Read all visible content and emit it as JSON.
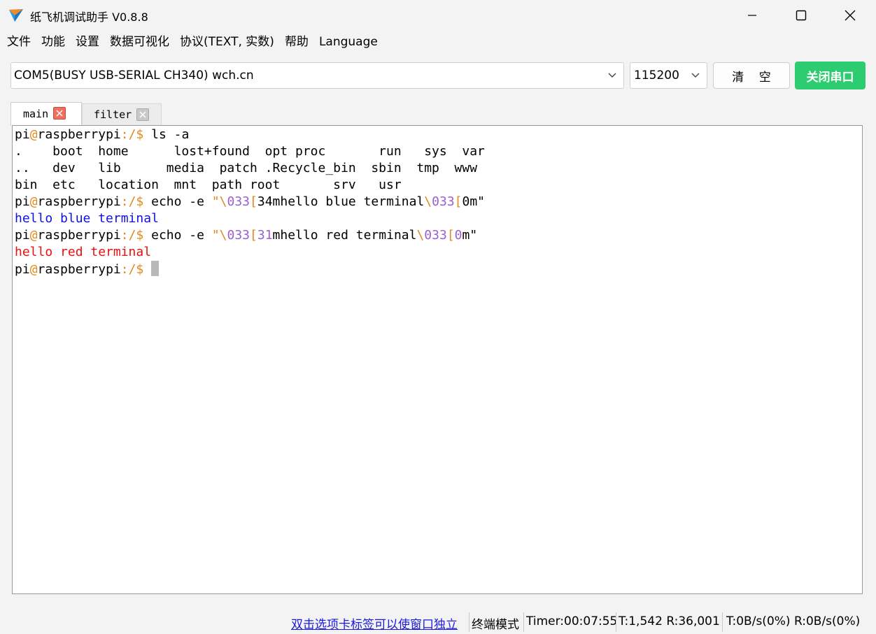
{
  "window": {
    "title": "纸飞机调试助手 V0.8.8",
    "accent": "#2ecc71"
  },
  "menu": [
    "文件",
    "功能",
    "设置",
    "数据可视化",
    "协议(TEXT, 实数)",
    "帮助",
    "Language"
  ],
  "toolbar": {
    "port": "COM5(BUSY  USB-SERIAL CH340) wch.cn",
    "baud": "115200",
    "clear_label": "清 空",
    "close_port_label": "关闭串口"
  },
  "tabs": [
    {
      "label": "main",
      "active": true
    },
    {
      "label": "filter",
      "active": false
    }
  ],
  "terminal": {
    "prompt_user": "pi",
    "prompt_at": "@",
    "prompt_host": "raspberrypi",
    "prompt_path": ":/$",
    "cmd1": " ls -a",
    "ls_rows": [
      ".    boot  home      lost+found  opt proc       run   sys  var",
      "..   dev   lib      media  patch .Recycle_bin  sbin  tmp  www",
      "bin  etc   location  mnt  path root       srv   usr"
    ],
    "echo_prefix": " echo -e ",
    "quote": "\"",
    "backslash": "\\",
    "esc_code": "033",
    "bracket": "[",
    "blue_code": "34",
    "red_code": "31",
    "blue_msg": "mhello blue terminal",
    "red_msg": "mhello red terminal",
    "reset_zero": "0",
    "reset_tail": "m\"",
    "blue_output": "hello blue terminal",
    "red_output": "hello red terminal",
    "colors": {
      "blue": "#1010e0",
      "red": "#e81010",
      "accent": "#e08a20",
      "escape": "#9a60d0"
    }
  },
  "status": {
    "hint": "双击选项卡标签可以使窗口独立",
    "mode": "终端模式",
    "timer": "Timer:00:07:55",
    "counts": "T:1,542 R:36,001",
    "rates": "T:0B/s(0%) R:0B/s(0%)"
  }
}
